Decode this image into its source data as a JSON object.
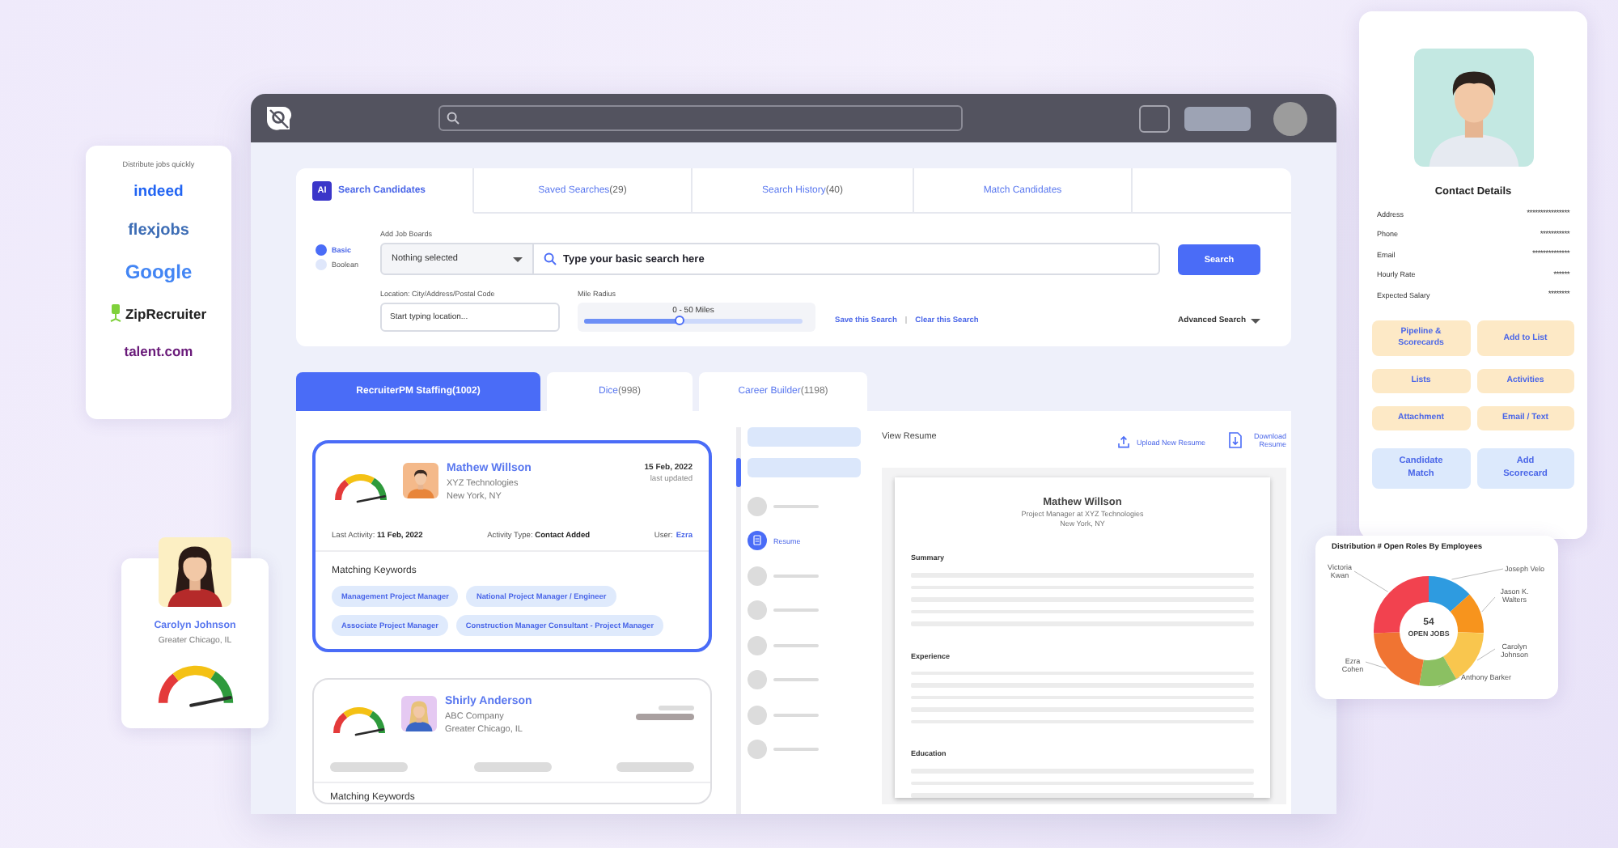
{
  "app": {
    "search": {
      "tabs": [
        {
          "label": "Search Candidates",
          "badge": "AI",
          "selected": true
        },
        {
          "label": "Saved Searches",
          "count": "(29)",
          "selected": false
        },
        {
          "label": "Search History",
          "count": "(40)",
          "selected": false
        },
        {
          "label": "Match Candidates",
          "selected": false
        }
      ],
      "modes": [
        {
          "label": "Basic",
          "selected": true
        },
        {
          "label": "Boolean",
          "selected": false
        }
      ],
      "job_boards": {
        "label": "Add Job Boards",
        "value": "Nothing selected"
      },
      "query": {
        "placeholder": "Type your basic search here"
      },
      "search_button": "Search",
      "location": {
        "label": "Location: City/Address/Postal Code",
        "placeholder": "Start typing location..."
      },
      "radius": {
        "label": "Mile Radius",
        "reading": "0 - 50 Miles",
        "level": 0.44
      },
      "links": [
        "Save this Search",
        "Clear this Search"
      ],
      "separator": "|",
      "advanced": "Advanced Search"
    },
    "sources": [
      {
        "label": "RecruiterPM Staffing",
        "count": "(1002)",
        "selected": true
      },
      {
        "label": "Dice",
        "count": "(998)",
        "selected": false
      },
      {
        "label": "Career Builder",
        "count": "(1198)",
        "selected": false
      }
    ],
    "candidates": [
      {
        "name": "Mathew Willson",
        "company": "XYZ Technologies",
        "location": "New York, NY",
        "date": "15 Feb, 2022",
        "date_note": "last updated",
        "selected": true,
        "activity": [
          {
            "kind": "text",
            "text": "Last Activity: **11 Feb, 2022**"
          },
          {
            "kind": "text",
            "text": "Activity Type: **Contact Added**"
          },
          {
            "kind": "user",
            "label": "User:",
            "link": "Ezra"
          }
        ],
        "keywords_title": "Matching Keywords",
        "keywords": [
          "Management Project Manager",
          "National Project Manager / Engineer",
          "Associate Project Manager",
          "Construction Manager Consultant - Project Manager"
        ]
      },
      {
        "name": "Shirly Anderson",
        "company": "ABC Company",
        "location": "Greater Chicago, IL",
        "selected": false,
        "keywords_title": "Matching Keywords"
      }
    ],
    "resume_nav": {
      "label": "Resume",
      "selected": true
    },
    "resume": {
      "title": "View Resume",
      "upload": "Upload New Resume",
      "download": "Download Resume",
      "name": "Mathew Willson",
      "headline": "Project Manager at XYZ Technologies",
      "location": "New York, NY",
      "sections": [
        "Summary",
        "Experience",
        "Education"
      ]
    }
  },
  "job_boards_card": {
    "title": "Distribute jobs quickly",
    "boards": [
      {
        "name": "indeed",
        "kind": "text",
        "color": "#2164f3"
      },
      {
        "name": "flexjobs",
        "kind": "text",
        "color": "#3d6db5"
      },
      {
        "name": "Google",
        "kind": "text",
        "color": "#4285f4"
      },
      {
        "name": "ZipRecruiter",
        "kind": "icon",
        "color": "#222222"
      },
      {
        "name": "talent.com",
        "kind": "text",
        "color": "#6a1b7a"
      }
    ]
  },
  "profile_card": {
    "name": "Carolyn Johnson",
    "location": "Greater Chicago, IL"
  },
  "contact_card": {
    "title": "Contact Details",
    "fields": [
      {
        "label": "Address",
        "value": "****************"
      },
      {
        "label": "Phone",
        "value": "***********"
      },
      {
        "label": "Email",
        "value": "**************"
      },
      {
        "label": "Hourly Rate",
        "value": "******"
      },
      {
        "label": "Expected Salary",
        "value": "********"
      }
    ],
    "buttons": [
      {
        "label": "Pipeline & Scorecards",
        "kind": "action"
      },
      {
        "label": "Add to List",
        "kind": "action"
      },
      {
        "label": "Lists",
        "kind": "action"
      },
      {
        "label": "Activities",
        "kind": "action"
      },
      {
        "label": "Attachment",
        "kind": "action"
      },
      {
        "label": "Email / Text",
        "kind": "action"
      },
      {
        "label": "Candidate Match",
        "kind": "primary"
      },
      {
        "label": "Add Scorecard",
        "kind": "primary"
      }
    ]
  },
  "chart_card": {
    "title": "Distribution # Open Roles By Employees",
    "total": "54",
    "total_label": "OPEN JOBS",
    "slices": [
      {
        "label": "Joseph Velo",
        "color": "#2e9be0"
      },
      {
        "label": "Jason K. Walters",
        "color": "#f7941d"
      },
      {
        "label": "Carolyn Johnson",
        "color": "#f9c64e"
      },
      {
        "label": "Anthony Barker",
        "color": "#8bc062"
      },
      {
        "label": "Ezra Cohen",
        "color": "#f07432"
      },
      {
        "label": "Victoria Kwan",
        "color": "#f2424f"
      }
    ]
  }
}
